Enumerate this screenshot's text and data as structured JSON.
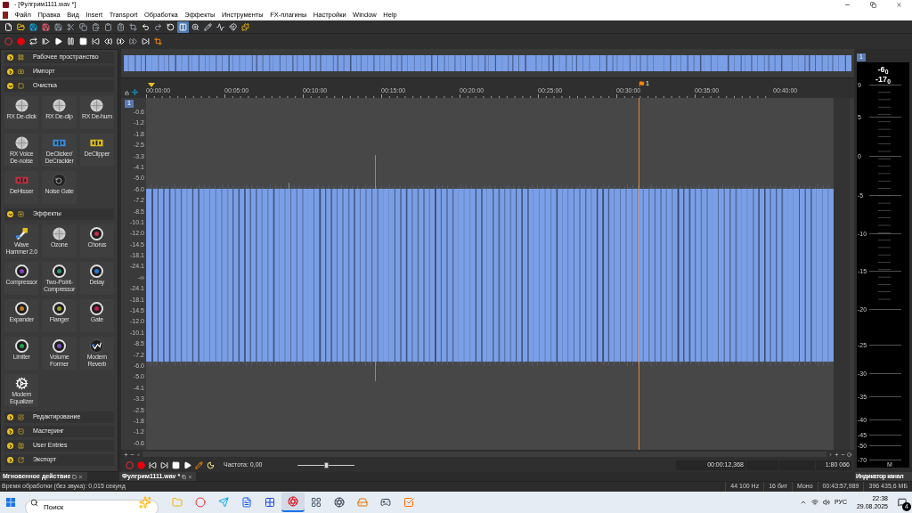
{
  "window": {
    "title": "- [Фулгрим1111.wav *]"
  },
  "menu": [
    "Файл",
    "Правка",
    "Вид",
    "Insert",
    "Transport",
    "Обработка",
    "Эффекты",
    "Инструменты",
    "FX-плагины",
    "Настройки",
    "Window",
    "Help"
  ],
  "toolbar": [
    {
      "kind": "new",
      "selected": false
    },
    {
      "kind": "open",
      "selected": false
    },
    {
      "kind": "save",
      "selected": false
    },
    {
      "kind": "save-as",
      "selected": false
    },
    {
      "kind": "save-all",
      "selected": false
    },
    {
      "kind": "cut",
      "selected": false
    },
    {
      "kind": "copy",
      "selected": false
    },
    {
      "kind": "paste",
      "selected": false
    },
    {
      "kind": "paste-mix",
      "selected": false
    },
    {
      "kind": "paste-crossfade",
      "selected": false
    },
    {
      "kind": "trim",
      "selected": false
    },
    {
      "kind": "undo",
      "selected": false
    },
    {
      "kind": "redo",
      "selected": false
    },
    {
      "kind": "repeat",
      "selected": false
    },
    {
      "kind": "edit-tool",
      "selected": true
    },
    {
      "kind": "zoom-tool",
      "selected": false
    },
    {
      "kind": "pencil-tool",
      "selected": false
    },
    {
      "kind": "envelope-tool",
      "selected": false
    },
    {
      "kind": "snap",
      "selected": false
    },
    {
      "kind": "plugin",
      "selected": false
    }
  ],
  "transport": [
    {
      "kind": "arm"
    },
    {
      "kind": "record"
    },
    {
      "kind": "loop"
    },
    {
      "kind": "play-all"
    },
    {
      "kind": "play"
    },
    {
      "kind": "pause"
    },
    {
      "kind": "stop"
    },
    {
      "kind": "start"
    },
    {
      "kind": "rewind"
    },
    {
      "kind": "forward"
    },
    {
      "kind": "next"
    },
    {
      "kind": "end"
    },
    {
      "kind": "metronome"
    }
  ],
  "panel": {
    "sections": [
      {
        "label": "Рабочее пространство",
        "kind": "workspace",
        "expanded": false
      },
      {
        "label": "Импорт",
        "kind": "import",
        "expanded": false
      },
      {
        "label": "Очистка",
        "kind": "clean",
        "expanded": true,
        "tiles": [
          {
            "label": "RX De-click",
            "kind": "disc"
          },
          {
            "label": "RX De-clip",
            "kind": "disc"
          },
          {
            "label": "RX De-hum",
            "kind": "disc"
          },
          {
            "label": "RX Voice De-noise",
            "kind": "disc"
          },
          {
            "label": "DeClicker/ DeCrackler",
            "kind": "bars",
            "color": "#3a8ad8"
          },
          {
            "label": "DeClipper",
            "kind": "bars",
            "color": "#e0c020"
          },
          {
            "label": "DeHisser",
            "kind": "bars",
            "color": "#c03040"
          },
          {
            "label": "Noise Gate",
            "kind": "gate"
          }
        ]
      },
      {
        "label": "Эффекты",
        "kind": "effects",
        "expanded": true,
        "tiles": [
          {
            "label": "Wave Hammer 2.0",
            "kind": "hammer"
          },
          {
            "label": "Ozone",
            "kind": "disc"
          },
          {
            "label": "Chorus",
            "kind": "knob",
            "color": "#c0304a"
          },
          {
            "label": "Compressor",
            "kind": "knob",
            "color": "#8a3fc0"
          },
          {
            "label": "Two-Point-Compressor",
            "kind": "knob",
            "color": "#2a9a6a"
          },
          {
            "label": "Delay",
            "kind": "knob",
            "color": "#2a7ad0"
          },
          {
            "label": "Expander",
            "kind": "knob",
            "color": "#c07a20"
          },
          {
            "label": "Flanger",
            "kind": "knob",
            "color": "#9aa030"
          },
          {
            "label": "Gate",
            "kind": "knob",
            "color": "#c02050"
          },
          {
            "label": "Limiter",
            "kind": "knob",
            "color": "#20a050"
          },
          {
            "label": "Volume Former",
            "kind": "knob",
            "color": "#7a50c0"
          },
          {
            "label": "Modern Reverb",
            "kind": "reverb"
          },
          {
            "label": "Modern Equalizer",
            "kind": "equalizer"
          }
        ]
      },
      {
        "label": "Редактирование",
        "kind": "edit",
        "expanded": false
      },
      {
        "label": "Мастеринг",
        "kind": "master",
        "expanded": false
      },
      {
        "label": "User Entries",
        "kind": "user",
        "expanded": false
      },
      {
        "label": "Экспорт",
        "kind": "export",
        "expanded": false
      }
    ]
  },
  "ruler": {
    "labels": [
      "00:00:00",
      "00:05:00",
      "00:10:00",
      "00:15:00",
      "00:20:00",
      "00:25:00",
      "00:30:00",
      "00:35:00",
      "00:40:00"
    ],
    "marker": "1"
  },
  "track": {
    "number": "1",
    "amplitude_labels": [
      "-0.6",
      "-1.2",
      "-1.8",
      "-2.5",
      "-3.3",
      "-4.1",
      "-5.0",
      "-6.0",
      "-7.2",
      "-8.5",
      "-10.1",
      "-12.0",
      "-14.5",
      "-18.1",
      "-24.1",
      "-∞",
      "-24.1",
      "-18.1",
      "-14.5",
      "-12.0",
      "-10.1",
      "-8.5",
      "-7.2",
      "-6.0",
      "-5.0",
      "-4.1",
      "-3.3",
      "-2.5",
      "-1.8",
      "-1.2",
      "-0.6"
    ]
  },
  "editor_transport": {
    "buttons": [
      {
        "kind": "arm"
      },
      {
        "kind": "record"
      },
      {
        "kind": "start"
      },
      {
        "kind": "end"
      },
      {
        "kind": "stop"
      },
      {
        "kind": "play"
      },
      {
        "kind": "marker"
      },
      {
        "kind": "scrub"
      }
    ],
    "rate": "Частота: 0,00",
    "level": 0.5,
    "readouts": [
      "00:00:12,368",
      "1:80 066"
    ]
  },
  "meter": {
    "channel": "1",
    "peaks": [
      "-6$_{0}$",
      "-17$_{0}$"
    ],
    "scale": [
      "9",
      "5",
      "0",
      "-5",
      "-10",
      "-15",
      "-20",
      "-25",
      "-30",
      "-35",
      "-40",
      "-45",
      "-50",
      "-70"
    ],
    "channel_label": "M"
  },
  "dock_tabs": [
    {
      "label": "Мгновенное действие"
    },
    {
      "label": "Фулгрим1111.wav *"
    },
    {
      "label": "Индикатор канал"
    }
  ],
  "status_bar": {
    "message": "Время обработки (без звука): 0,015 секунд",
    "fields": [
      "44 100 Hz",
      "16 бит",
      "Моно",
      "00:43:57,989",
      "396 435,6 МБ"
    ]
  },
  "taskbar": {
    "search": {
      "placeholder": "Поиск"
    },
    "apps": [
      {
        "kind": "explorer",
        "selected": false
      },
      {
        "kind": "browser",
        "selected": false
      },
      {
        "kind": "messenger",
        "selected": false
      },
      {
        "kind": "document",
        "selected": false
      },
      {
        "kind": "dots",
        "selected": false
      },
      {
        "kind": "audio-editor",
        "selected": true
      },
      {
        "kind": "grid",
        "selected": false
      },
      {
        "kind": "recorder",
        "selected": false
      },
      {
        "kind": "disk",
        "selected": false
      },
      {
        "kind": "game",
        "selected": false
      },
      {
        "kind": "tasks",
        "selected": false
      }
    ],
    "language": "РУС",
    "time": "22:38",
    "date": "29.08.2025",
    "notifications": "4"
  }
}
